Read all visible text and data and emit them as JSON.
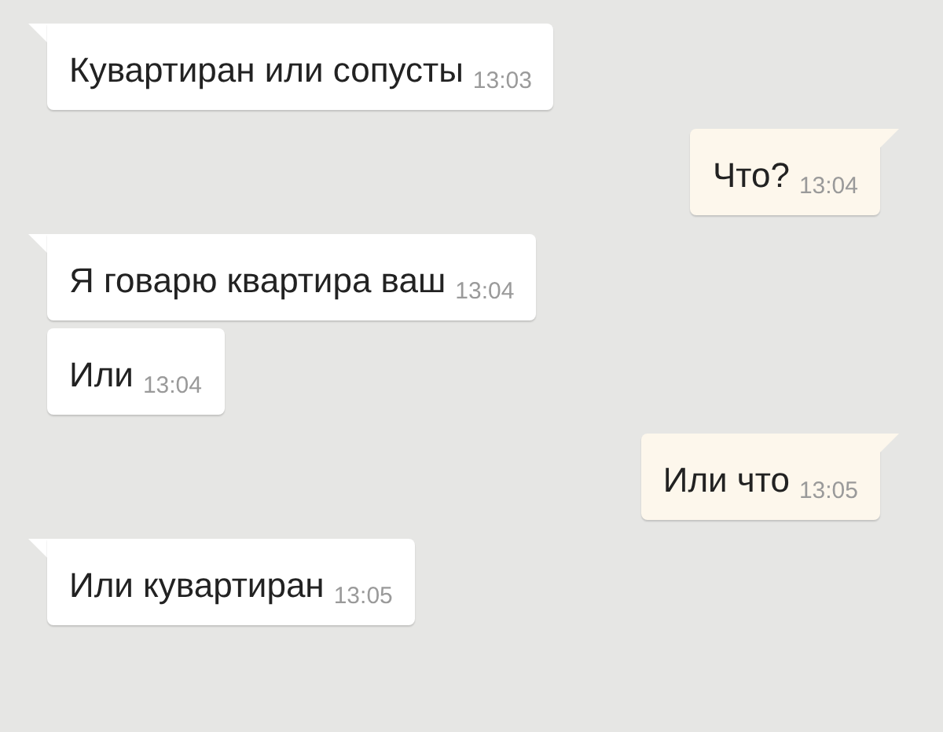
{
  "messages": [
    {
      "kind": "incoming",
      "text": "Кувартиран или сопусты",
      "time": "13:03",
      "tail": true
    },
    {
      "kind": "outgoing",
      "text": "Что?",
      "time": "13:04",
      "tail": true
    },
    {
      "kind": "incoming",
      "text": "Я говарю квартира ваш",
      "time": "13:04",
      "tail": true
    },
    {
      "kind": "incoming",
      "text": "Или",
      "time": "13:04",
      "tail": false
    },
    {
      "kind": "outgoing",
      "text": "Или что",
      "time": "13:05",
      "tail": true
    },
    {
      "kind": "incoming",
      "text": "Или кувартиран",
      "time": "13:05",
      "tail": true
    }
  ]
}
